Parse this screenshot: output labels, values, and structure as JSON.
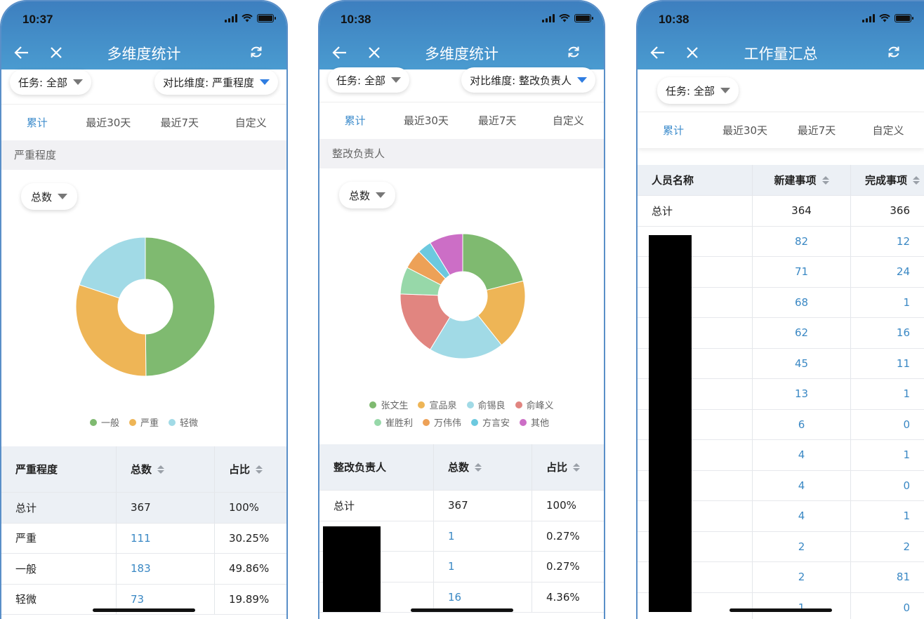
{
  "colors": {
    "accent": "#3d8ccc",
    "header": "#4490cb",
    "green": "#7fba70",
    "orange": "#eeb556",
    "lightblue": "#a1dae6",
    "red": "#e18580",
    "mint": "#97d8a9",
    "darkorange": "#eda157",
    "cyan": "#6cc9df",
    "purple": "#cc6ec6"
  },
  "screens": [
    {
      "time": "10:37",
      "title": "多维度统计",
      "task_filter": "任务: 全部",
      "compare_filter": "对比维度: 严重程度",
      "tabs": [
        "累计",
        "最近30天",
        "最近7天",
        "自定义"
      ],
      "section": "严重程度",
      "metric_select": "总数",
      "chart_data": {
        "type": "pie",
        "categories": [
          "一般",
          "严重",
          "轻微"
        ],
        "values": [
          183,
          111,
          73
        ],
        "colors": [
          "#7fba70",
          "#eeb556",
          "#a1dae6"
        ],
        "donut": true
      },
      "table": {
        "headers": [
          "严重程度",
          "总数",
          "占比"
        ],
        "rows": [
          [
            "总计",
            "367",
            "100%"
          ],
          [
            "严重",
            "111",
            "30.25%"
          ],
          [
            "一般",
            "183",
            "49.86%"
          ],
          [
            "轻微",
            "73",
            "19.89%"
          ]
        ]
      }
    },
    {
      "time": "10:38",
      "title": "多维度统计",
      "task_filter": "任务: 全部",
      "compare_filter": "对比维度: 整改负责人",
      "tabs": [
        "累计",
        "最近30天",
        "最近7天",
        "自定义"
      ],
      "section": "整改负责人",
      "metric_select": "总数",
      "chart_data": {
        "type": "pie",
        "categories": [
          "张文生",
          "宣品泉",
          "俞锡良",
          "俞峰义",
          "崔胜利",
          "万伟伟",
          "方言安",
          "其他"
        ],
        "values": [
          75,
          65,
          69,
          60,
          25,
          18,
          13,
          31
        ],
        "colors": [
          "#7fba70",
          "#eeb556",
          "#a1dae6",
          "#e18580",
          "#97d8a9",
          "#eda157",
          "#6cc9df",
          "#cc6ec6"
        ],
        "donut": true
      },
      "table": {
        "headers": [
          "整改负责人",
          "总数",
          "占比"
        ],
        "rows": [
          [
            "总计",
            "367",
            "100%"
          ],
          [
            "",
            "1",
            "0.27%"
          ],
          [
            "",
            "1",
            "0.27%"
          ],
          [
            "",
            "16",
            "4.36%"
          ]
        ]
      }
    },
    {
      "time": "10:38",
      "title": "工作量汇总",
      "task_filter": "任务: 全部",
      "tabs": [
        "累计",
        "最近30天",
        "最近7天",
        "自定义"
      ],
      "table": {
        "headers": [
          "人员名称",
          "新建事项",
          "完成事项"
        ],
        "rows": [
          [
            "总计",
            "364",
            "366"
          ],
          [
            "",
            "82",
            "12"
          ],
          [
            "",
            "71",
            "24"
          ],
          [
            "",
            "68",
            "1"
          ],
          [
            "",
            "62",
            "16"
          ],
          [
            "",
            "45",
            "11"
          ],
          [
            "",
            "13",
            "1"
          ],
          [
            "",
            "6",
            "0"
          ],
          [
            "",
            "4",
            "1"
          ],
          [
            "",
            "4",
            "0"
          ],
          [
            "",
            "4",
            "1"
          ],
          [
            "",
            "2",
            "2"
          ],
          [
            "",
            "2",
            "81"
          ],
          [
            "",
            "1",
            "0"
          ]
        ]
      }
    }
  ]
}
